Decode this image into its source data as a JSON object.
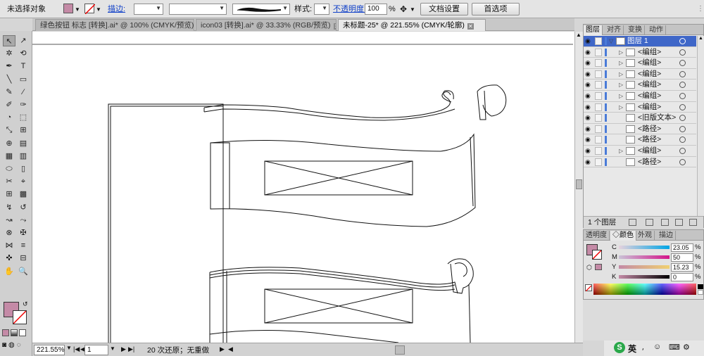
{
  "control_bar": {
    "selection_status": "未选择对象",
    "stroke_label": "描边:",
    "opacity_label": "不透明度:",
    "opacity_value": "100",
    "opacity_unit": "%",
    "style_label": "样式:",
    "document_setup_button": "文档设置",
    "preferences_button": "首选项",
    "fill_color": "#c48aa6",
    "dropdown_arrow": "▼",
    "brush_preview_icon": "brush-stroke-icon"
  },
  "tabs": [
    {
      "label": "绿色按钮 标志 [转换].ai* @ 100% (CMYK/预览)",
      "close": "✕"
    },
    {
      "label": "icon03 [转换].ai* @ 33.33% (RGB/预览)",
      "close": "✕"
    },
    {
      "label": "未标题-25* @ 221.55% (CMYK/轮廓)",
      "close": "✕"
    }
  ],
  "tools": [
    "↖",
    "↗",
    "✲",
    "⟲",
    "✒",
    "T",
    "╲",
    "▭",
    "✎",
    "⁄",
    "✐",
    "✑",
    "◔",
    "⬚",
    "⤡",
    "⊞",
    "⊕",
    "▤",
    "▦",
    "▥",
    "⬭",
    "▯",
    "✂",
    "⌖",
    "⊞",
    "▩",
    "↯",
    "↺",
    "↝",
    "⤳",
    "⊗",
    "✠",
    "⋈",
    "≡",
    "✜",
    "⊟",
    "✋",
    "🔍"
  ],
  "tool_colors": {
    "fill": "#c48aa6",
    "stroke": "none"
  },
  "status_bar": {
    "zoom": "221.55%",
    "page": "1",
    "history": "20 次还原；无重做",
    "nav_first": "|◀",
    "nav_prev": "◀",
    "nav_next": "▶",
    "nav_last": "▶|",
    "play": "▶"
  },
  "layers_panel": {
    "tabs": [
      "图层",
      "对齐",
      "变换",
      "动作"
    ],
    "rows": [
      {
        "name": "图层 1",
        "head": true,
        "twisty": "▽"
      },
      {
        "name": "<编组>",
        "twisty": "▷"
      },
      {
        "name": "<编组>",
        "twisty": "▷"
      },
      {
        "name": "<编组>",
        "twisty": "▷"
      },
      {
        "name": "<编组>",
        "twisty": "▷"
      },
      {
        "name": "<编组>",
        "twisty": "▷"
      },
      {
        "name": "<编组>",
        "twisty": "▷"
      },
      {
        "name": "<旧版文本>",
        "twisty": ""
      },
      {
        "name": "<路径>",
        "twisty": ""
      },
      {
        "name": "<路径>",
        "twisty": ""
      },
      {
        "name": "<编组>",
        "twisty": "▷"
      },
      {
        "name": "<路径>",
        "twisty": ""
      }
    ],
    "eye_icon": "◉",
    "footer": "1 个图层"
  },
  "color_panel": {
    "tabs": [
      "透明度",
      "◇颜色",
      "外观",
      "描边"
    ],
    "channels": [
      {
        "label": "C",
        "value": "23.05"
      },
      {
        "label": "M",
        "value": "50"
      },
      {
        "label": "Y",
        "value": "15.23"
      },
      {
        "label": "K",
        "value": "0"
      }
    ],
    "unit": "%",
    "fill": "#c48aa6"
  },
  "tray": {
    "ime_label": "英"
  }
}
